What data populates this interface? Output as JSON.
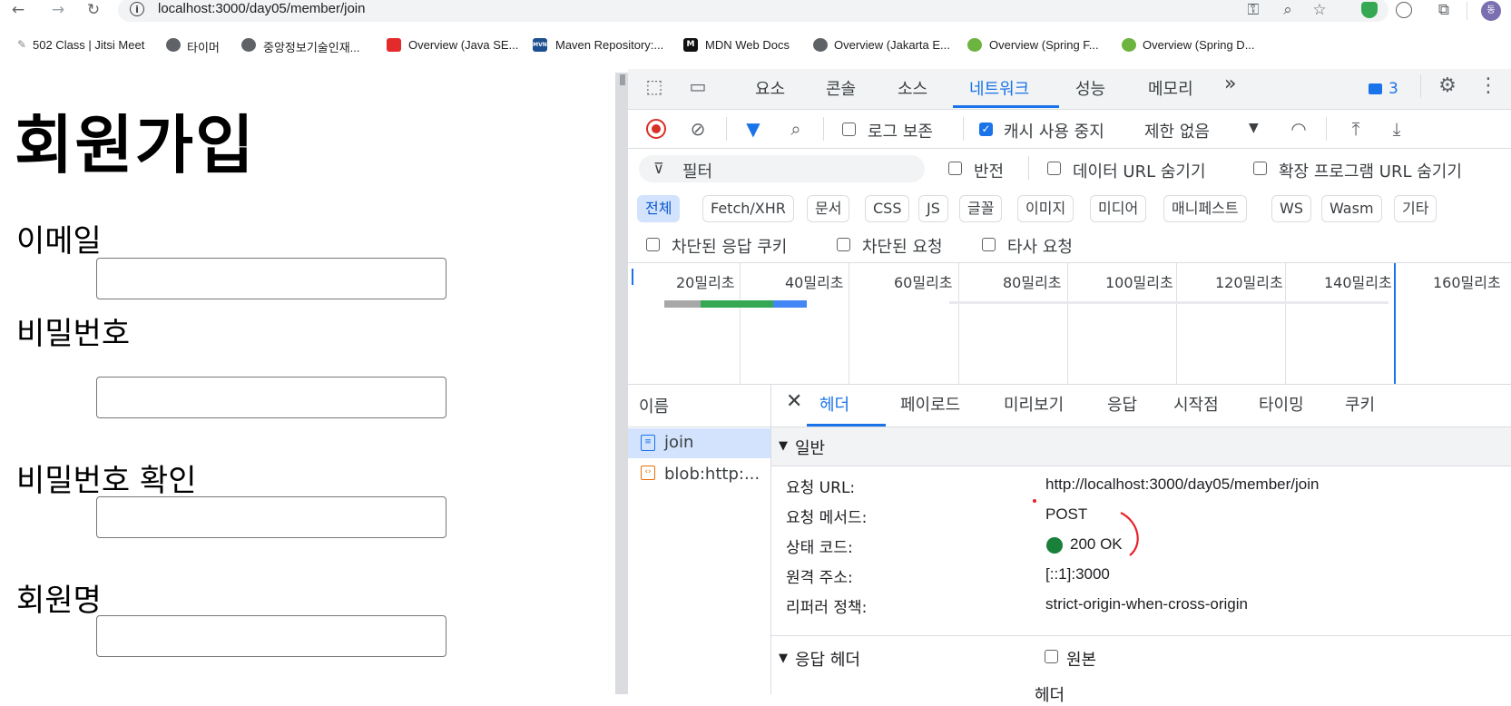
{
  "browser": {
    "url": "localhost:3000/day05/member/join",
    "bookmarks": [
      "502 Class | Jitsi Meet",
      "타이머",
      "중앙정보기술인재...",
      "Overview (Java SE...",
      "Maven Repository:...",
      "MDN Web Docs",
      "Overview (Jakarta E...",
      "Overview (Spring F...",
      "Overview (Spring D..."
    ],
    "bookmark_icon_text": {
      "mvn": "MVN",
      "mdn": "M"
    },
    "profile_initial": "동"
  },
  "page": {
    "title": "회원가입",
    "fields": [
      {
        "label": "이메일",
        "value": ""
      },
      {
        "label": "비밀번호",
        "value": ""
      },
      {
        "label": "비밀번호 확인",
        "value": ""
      },
      {
        "label": "회원명",
        "value": ""
      }
    ]
  },
  "devtools": {
    "tabs": [
      "요소",
      "콘솔",
      "소스",
      "네트워크",
      "성능",
      "메모리"
    ],
    "active_tab": "네트워크",
    "more": "»",
    "message_count": "3",
    "toolbar": {
      "preserve_log": "로그 보존",
      "disable_cache": "캐시 사용 중지",
      "throttle": "제한 없음"
    },
    "filter": {
      "placeholder": "필터",
      "invert": "반전",
      "hide_data_urls": "데이터 URL 숨기기",
      "hide_ext_urls": "확장 프로그램 URL 숨기기"
    },
    "type_filters": [
      "전체",
      "Fetch/XHR",
      "문서",
      "CSS",
      "JS",
      "글꼴",
      "이미지",
      "미디어",
      "매니페스트",
      "WS",
      "Wasm",
      "기타"
    ],
    "blocked": {
      "blocked_cookies": "차단된 응답 쿠키",
      "blocked_requests": "차단된 요청",
      "third_party": "타사 요청"
    },
    "timeline_ticks": [
      "20밀리초",
      "40밀리초",
      "60밀리초",
      "80밀리초",
      "100밀리초",
      "120밀리초",
      "140밀리초",
      "160밀리초"
    ],
    "name_header": "이름",
    "requests": [
      "join",
      "blob:http:..."
    ],
    "detail_tabs": [
      "헤더",
      "페이로드",
      "미리보기",
      "응답",
      "시작점",
      "타이밍",
      "쿠키"
    ],
    "general": {
      "title": "일반",
      "rows": [
        {
          "label": "요청 URL:",
          "value": "http://localhost:3000/day05/member/join"
        },
        {
          "label": "요청 메서드:",
          "value": "POST"
        },
        {
          "label": "상태 코드:",
          "value": "200 OK"
        },
        {
          "label": "원격 주소:",
          "value": "[::1]:3000"
        },
        {
          "label": "리퍼러 정책:",
          "value": "strict-origin-when-cross-origin"
        }
      ]
    },
    "response_headers": {
      "title": "응답 헤더",
      "raw": "원본",
      "partial": "헤더"
    }
  },
  "colors": {
    "accent": "#1a73e8",
    "status_ok": "#188038",
    "record": "#d93025",
    "annotation": "#e8222a"
  }
}
